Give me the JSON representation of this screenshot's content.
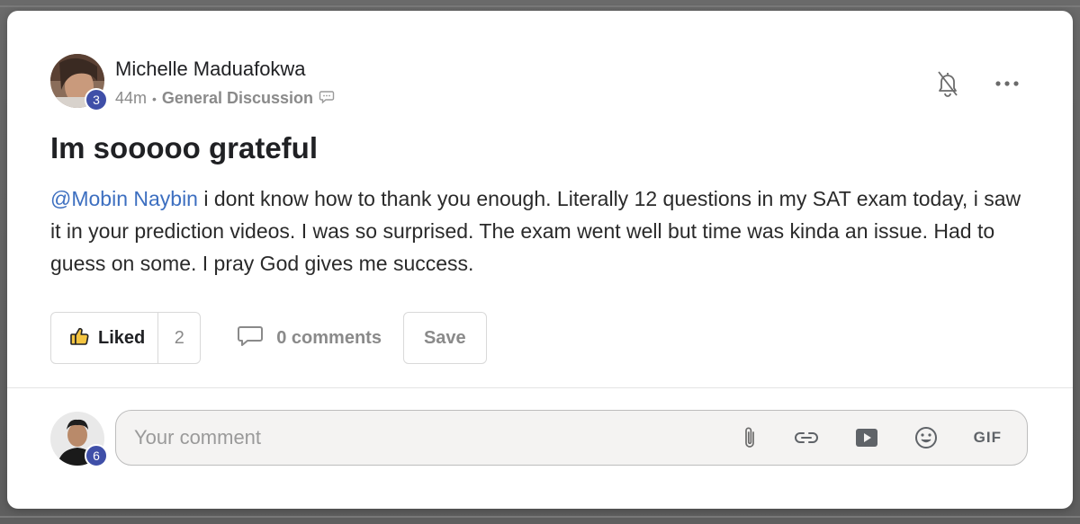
{
  "post": {
    "author": {
      "name": "Michelle Maduafokwa",
      "level": "3"
    },
    "time_ago": "44m",
    "category": "General Discussion",
    "title": "Im sooooo grateful",
    "mention": "@Mobin Naybin",
    "body": " i dont know how to thank you enough. Literally 12 questions in my SAT exam today, i saw it in your prediction videos. I was so surprised. The exam went well but time was kinda an issue. Had to guess on some. I pray God gives me success."
  },
  "actions": {
    "like_label": "Liked",
    "like_count": "2",
    "comments_label": "0 comments",
    "save_label": "Save"
  },
  "composer": {
    "user_level": "6",
    "placeholder": "Your comment",
    "gif_label": "GIF"
  },
  "icons": {
    "notifications": "bell-off-icon",
    "more": "more-horizontal-icon",
    "category": "speech-bubble-icon",
    "like": "thumbs-up-icon",
    "comments": "comment-icon",
    "attach": "paperclip-icon",
    "link": "link-icon",
    "video": "video-icon",
    "emoji": "emoji-icon"
  },
  "colors": {
    "mention": "#3d6fc0",
    "level_badge": "#3f4fa8",
    "like_icon_fill": "#f4c542"
  }
}
